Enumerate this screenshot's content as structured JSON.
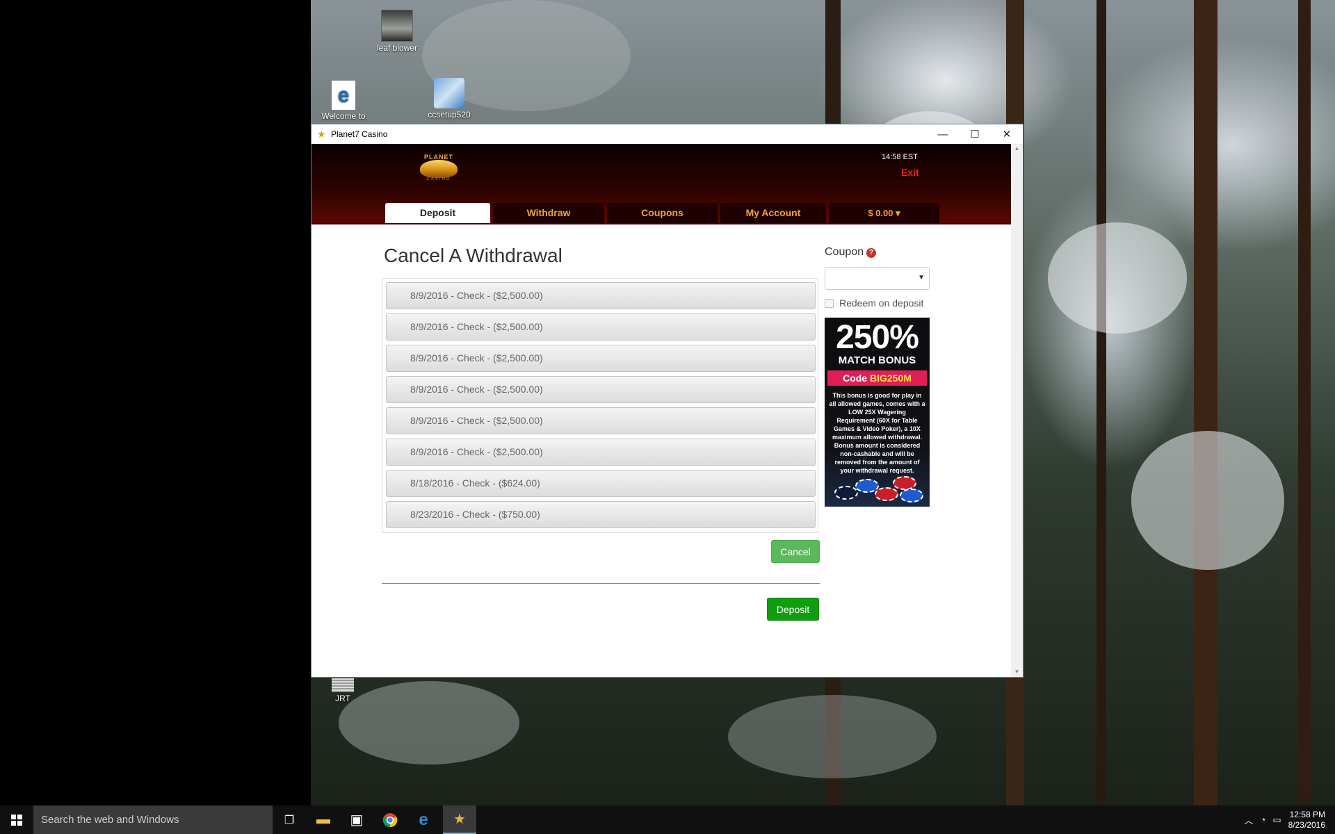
{
  "desktop": {
    "icons": [
      {
        "name": "leaf-blower-icon",
        "label": "leaf blower"
      },
      {
        "name": "edge-welcome-icon",
        "label": "Welcome to"
      },
      {
        "name": "ccsetup-icon",
        "label": "ccsetup520"
      },
      {
        "name": "jrt-icon",
        "label": "JRT"
      }
    ]
  },
  "window": {
    "title": "Planet7 Casino",
    "controls": {
      "minimize": "—",
      "maximize": "☐",
      "close": "✕"
    }
  },
  "header": {
    "logo_top": "PLANET",
    "logo_sub": "CASINO",
    "time": "14:58 EST",
    "exit_label": "Exit",
    "tabs": [
      {
        "label": "Deposit",
        "active": true
      },
      {
        "label": "Withdraw",
        "active": false
      },
      {
        "label": "Coupons",
        "active": false
      },
      {
        "label": "My Account",
        "active": false
      },
      {
        "label": "$ 0.00 ▾",
        "active": false
      }
    ]
  },
  "main": {
    "title": "Cancel A Withdrawal",
    "withdrawals": [
      "8/9/2016 - Check - ($2,500.00)",
      "8/9/2016 - Check - ($2,500.00)",
      "8/9/2016 - Check - ($2,500.00)",
      "8/9/2016 - Check - ($2,500.00)",
      "8/9/2016 - Check - ($2,500.00)",
      "8/9/2016 - Check - ($2,500.00)",
      "8/18/2016 - Check - ($624.00)",
      "8/23/2016 - Check - ($750.00)"
    ],
    "cancel_button": "Cancel",
    "deposit_button": "Deposit"
  },
  "coupon": {
    "label": "Coupon",
    "help": "?",
    "select_value": "",
    "redeem_label": "Redeem on deposit",
    "redeem_checked": false
  },
  "promo": {
    "headline": "250%",
    "subhead": "MATCH BONUS",
    "code_prefix": "Code",
    "code": "BIG250M",
    "terms": "This bonus is good for play in all allowed games, comes with a LOW 25X Wagering Requirement (60X for Table Games & Video Poker), a 10X maximum allowed withdrawal. Bonus amount is considered non-cashable and will be removed from the amount of your withdrawal request."
  },
  "taskbar": {
    "search_placeholder": "Search the web and Windows",
    "time": "12:58 PM",
    "date": "8/23/2016"
  },
  "colors": {
    "accent_tab": "#f0a33a",
    "exit": "#e8231c",
    "cancel_btn": "#5cb85c",
    "deposit_btn": "#109e10",
    "promo_code_bg": "#e01e56"
  }
}
